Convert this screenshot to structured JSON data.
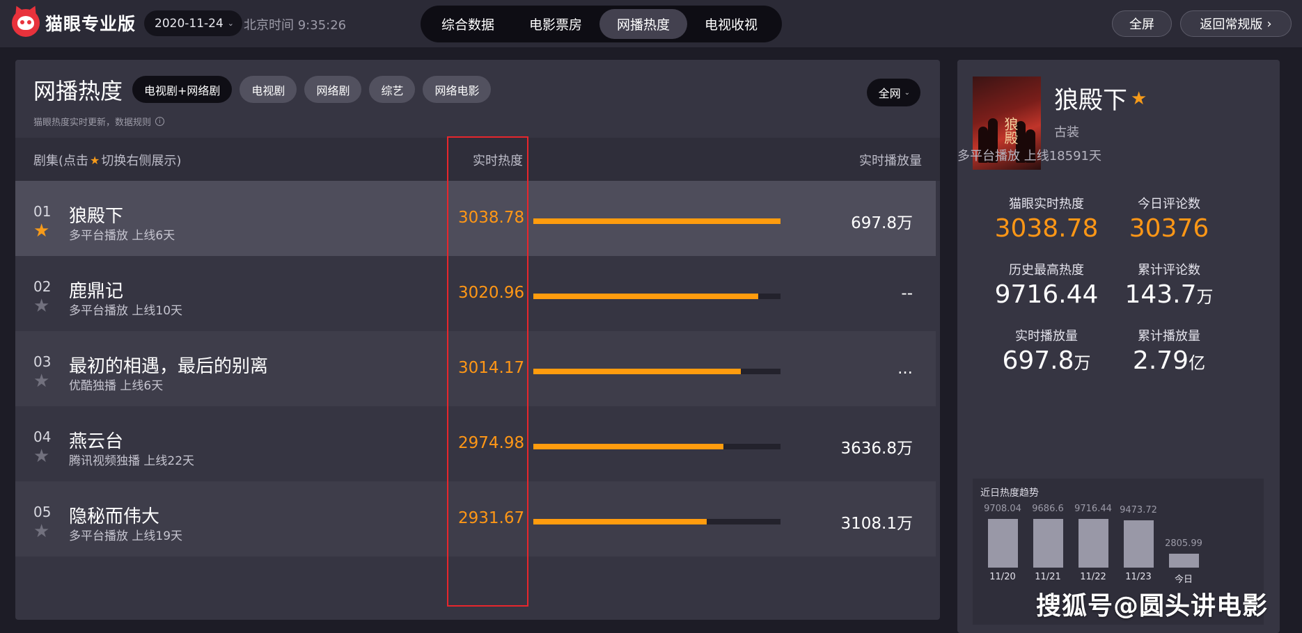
{
  "app": {
    "name": "猫眼专业版"
  },
  "topbar": {
    "date": "2020-11-24",
    "beijing_time": "北京时间 9:35:26",
    "nav": [
      {
        "label": "综合数据",
        "active": false
      },
      {
        "label": "电影票房",
        "active": false
      },
      {
        "label": "网播热度",
        "active": true
      },
      {
        "label": "电视收视",
        "active": false
      }
    ],
    "fullscreen_label": "全屏",
    "back_label": "返回常规版"
  },
  "list": {
    "title": "网播热度",
    "filters": [
      {
        "label": "电视剧+网络剧",
        "active": true
      },
      {
        "label": "电视剧",
        "active": false
      },
      {
        "label": "网络剧",
        "active": false
      },
      {
        "label": "综艺",
        "active": false
      },
      {
        "label": "网络电影",
        "active": false
      }
    ],
    "scope": "全网",
    "note": "猫眼热度实时更新，数据规则",
    "header": {
      "col_show_prefix": "剧集(点击",
      "col_show_suffix": "切换右侧展示)",
      "col_heat": "实时热度",
      "col_plays": "实时播放量"
    },
    "rows": [
      {
        "rank": "01",
        "name": "狼殿下",
        "sub": "多平台播放  上线6天",
        "heat": "3038.78",
        "heat_ratio": 1.0,
        "plays": "697.8万",
        "starred": true
      },
      {
        "rank": "02",
        "name": "鹿鼎记",
        "sub": "多平台播放  上线10天",
        "heat": "3020.96",
        "heat_ratio": 0.91,
        "plays": "--",
        "starred": false
      },
      {
        "rank": "03",
        "name": "最初的相遇，最后的别离",
        "sub": "优酷独播  上线6天",
        "heat": "3014.17",
        "heat_ratio": 0.84,
        "plays": "...",
        "starred": false
      },
      {
        "rank": "04",
        "name": "燕云台",
        "sub": "腾讯视频独播  上线22天",
        "heat": "2974.98",
        "heat_ratio": 0.77,
        "plays": "3636.8万",
        "starred": false
      },
      {
        "rank": "05",
        "name": "隐秘而伟大",
        "sub": "多平台播放  上线19天",
        "heat": "2931.67",
        "heat_ratio": 0.7,
        "plays": "3108.1万",
        "starred": false
      }
    ]
  },
  "detail": {
    "name": "狼殿下",
    "poster_text": "狼殿",
    "genre": "古装",
    "meta": "多平台播放  上线18591天",
    "stats": [
      {
        "label": "猫眼实时热度",
        "value": "3038.78",
        "unit": "",
        "orange": true
      },
      {
        "label": "今日评论数",
        "value": "30376",
        "unit": "",
        "orange": true
      },
      {
        "label": "历史最高热度",
        "value": "9716.44",
        "unit": "",
        "orange": false
      },
      {
        "label": "累计评论数",
        "value": "143.7",
        "unit": "万",
        "orange": false
      },
      {
        "label": "实时播放量",
        "value": "697.8",
        "unit": "万",
        "orange": false
      },
      {
        "label": "累计播放量",
        "value": "2.79",
        "unit": "亿",
        "orange": false
      }
    ],
    "trend": {
      "title": "近日热度趋势",
      "points": [
        {
          "date": "11/20",
          "value": 9708.04,
          "label": "9708.04"
        },
        {
          "date": "11/21",
          "value": 9686.6,
          "label": "9686.6"
        },
        {
          "date": "11/22",
          "value": 9716.44,
          "label": "9716.44"
        },
        {
          "date": "11/23",
          "value": 9473.72,
          "label": "9473.72"
        },
        {
          "date": "今日",
          "value": 2805.99,
          "label": "2805.99"
        }
      ]
    }
  },
  "watermark": "搜狐号@圆头讲电影",
  "colors": {
    "accent": "#ff9716",
    "highlight_box": "#e8262c",
    "bar": "#ff9c0e"
  }
}
